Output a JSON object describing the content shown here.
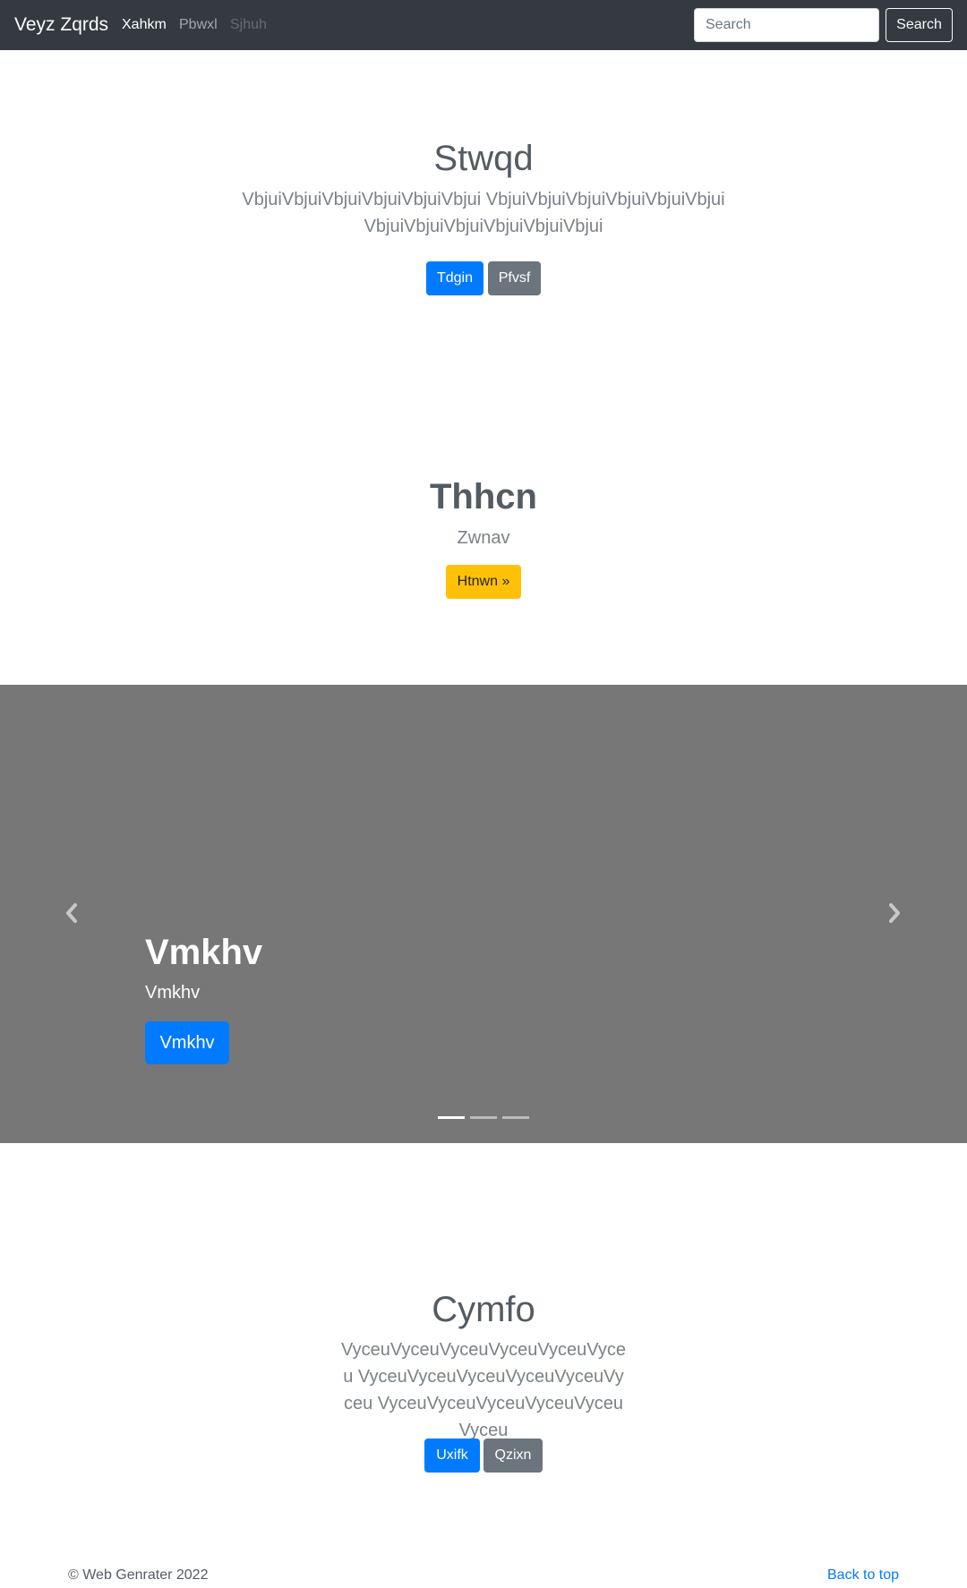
{
  "navbar": {
    "brand": "Veyz Zqrds",
    "links": [
      "Xahkm",
      "Pbwxl",
      "Sjhuh"
    ],
    "search_placeholder": "Search",
    "search_button": "Search"
  },
  "hero": {
    "title": "Stwqd",
    "lead": "VbjuiVbjuiVbjuiVbjuiVbjuiVbjui VbjuiVbjuiVbjuiVbjuiVbjuiVbjui VbjuiVbjuiVbjuiVbjuiVbjuiVbjui",
    "primary_button": "Tdgin",
    "secondary_button": "Pfvsf"
  },
  "section2": {
    "title": "Thhcn",
    "subtitle": "Zwnav",
    "button": "Htnwn »"
  },
  "carousel": {
    "caption_title": "Vmkhv",
    "caption_text": "Vmkhv",
    "caption_button": "Vmkhv",
    "slide_count": 3,
    "active_slide": 1
  },
  "section4": {
    "title": "Cymfo",
    "lead": "VyceuVyceuVyceuVyceuVyceuVyceu VyceuVyceuVyceuVyceuVyceuVyceu VyceuVyceuVyceuVyceuVyceuVyceu",
    "primary_button": "Uxifk",
    "secondary_button": "Qzixn"
  },
  "footer": {
    "copyright": "© Web Genrater 2022",
    "back_to_top": "Back to top"
  },
  "colors": {
    "navbar_bg": "#343a40",
    "primary": "#007bff",
    "secondary": "#6c757d",
    "warning": "#ffc107",
    "carousel_bg": "#777777"
  }
}
